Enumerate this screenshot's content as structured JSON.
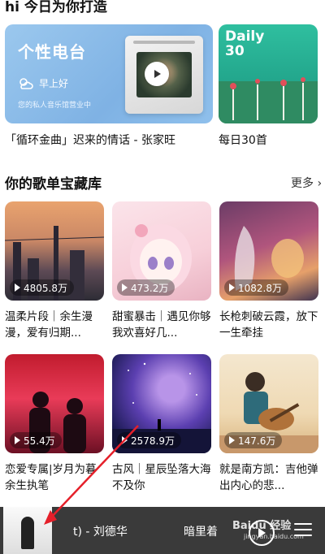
{
  "header": {
    "title": "hi 今日为你打造"
  },
  "recommend": {
    "personal_fm": {
      "title": "个性电台",
      "weather": "早上好",
      "subtitle": "您的私人音乐馆营业中",
      "caption": "「循环金曲」迟来的情话 - 张家旺"
    },
    "daily": {
      "logo_line1": "Daily",
      "logo_line2": "30",
      "caption": "每日30首"
    }
  },
  "section": {
    "title": "你的歌单宝藏库",
    "more": "更多 ›"
  },
  "playlists": [
    {
      "plays": "4805.8万",
      "title": "温柔片段｜余生漫漫，爱有归期..."
    },
    {
      "plays": "473.2万",
      "title": "甜蜜暴击｜遇见你够我欢喜好几..."
    },
    {
      "plays": "1082.8万",
      "title": "长枪刺破云霞，放下一生牵挂"
    },
    {
      "plays": "55.4万",
      "title": "恋爱专属|岁月为暮余生执笔"
    },
    {
      "plays": "2578.9万",
      "title": "古风｜星辰坠落大海不及你"
    },
    {
      "plays": "147.6万",
      "title": "就是南方凯：吉他弹出内心的悲..."
    }
  ],
  "player": {
    "now_playing": "t) - 刘德华",
    "next_preview": "暗里着",
    "watermark": "Baidu 经验",
    "watermark_sub": "jingyan.baidu.com"
  },
  "icons": {
    "weather": "sun-cloud-icon",
    "play": "play-icon",
    "list": "playlist-icon"
  }
}
